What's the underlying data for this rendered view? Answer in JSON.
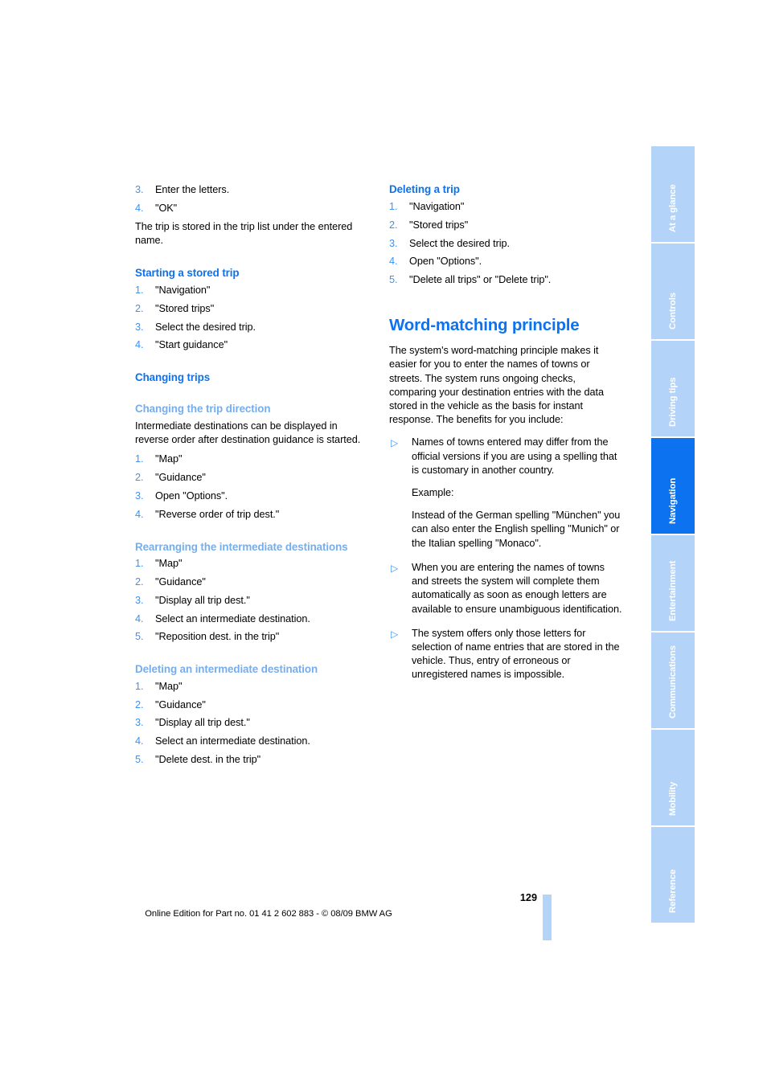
{
  "document": {
    "page_number": "129",
    "footer_text": "Online Edition for Part no. 01 41 2 602 883 - © 08/09 BMW AG"
  },
  "colors": {
    "accent_blue": "#0d72ef",
    "light_blue": "#76adec",
    "tab_blue": "#b4d3f9",
    "number_blue": "#3d93f2"
  },
  "left_column": {
    "continued_steps": [
      {
        "num": "3.",
        "text": "Enter the letters."
      },
      {
        "num": "4.",
        "text": "\"OK\""
      }
    ],
    "continued_para": "The trip is stored in the trip list under the entered name.",
    "starting_stored_trip": {
      "heading": "Starting a stored trip",
      "steps": [
        {
          "num": "1.",
          "text": "\"Navigation\""
        },
        {
          "num": "2.",
          "text": "\"Stored trips\""
        },
        {
          "num": "3.",
          "text": "Select the desired trip."
        },
        {
          "num": "4.",
          "text": "\"Start guidance\""
        }
      ]
    },
    "changing_trips": {
      "heading": "Changing trips"
    },
    "changing_direction": {
      "heading": "Changing the trip direction",
      "para": "Intermediate destinations can be displayed in reverse order after destination guidance is started.",
      "steps": [
        {
          "num": "1.",
          "text": "\"Map\""
        },
        {
          "num": "2.",
          "text": "\"Guidance\""
        },
        {
          "num": "3.",
          "text": "Open \"Options\"."
        },
        {
          "num": "4.",
          "text": "\"Reverse order of trip dest.\""
        }
      ]
    },
    "rearranging": {
      "heading": "Rearranging the intermediate destinations",
      "steps": [
        {
          "num": "1.",
          "text": "\"Map\""
        },
        {
          "num": "2.",
          "text": "\"Guidance\""
        },
        {
          "num": "3.",
          "text": "\"Display all trip dest.\""
        },
        {
          "num": "4.",
          "text": "Select an intermediate destination."
        },
        {
          "num": "5.",
          "text": "\"Reposition dest. in the trip\""
        }
      ]
    },
    "deleting_intermediate": {
      "heading": "Deleting an intermediate destination",
      "steps": [
        {
          "num": "1.",
          "text": "\"Map\""
        },
        {
          "num": "2.",
          "text": "\"Guidance\""
        },
        {
          "num": "3.",
          "text": "\"Display all trip dest.\""
        },
        {
          "num": "4.",
          "text": "Select an intermediate destination."
        },
        {
          "num": "5.",
          "text": "\"Delete dest. in the trip\""
        }
      ]
    }
  },
  "right_column": {
    "deleting_trip": {
      "heading": "Deleting a trip",
      "steps": [
        {
          "num": "1.",
          "text": "\"Navigation\""
        },
        {
          "num": "2.",
          "text": "\"Stored trips\""
        },
        {
          "num": "3.",
          "text": "Select the desired trip."
        },
        {
          "num": "4.",
          "text": "Open \"Options\"."
        },
        {
          "num": "5.",
          "text": "\"Delete all trips\" or \"Delete trip\"."
        }
      ]
    },
    "word_matching": {
      "title": "Word-matching principle",
      "intro": "The system's word-matching principle makes it easier for you to enter the names of towns or streets. The system runs ongoing checks, comparing your destination entries with the data stored in the vehicle as the basis for instant response. The benefits for you include:",
      "bullets": [
        {
          "marker": "triangle-right-icon",
          "text": "Names of towns entered may differ from the official versions if you are using a spelling that is customary in another country.",
          "example_label": "Example:",
          "example_text": "Instead of the German spelling \"München\" you can also enter the English spelling \"Munich\" or the Italian spelling \"Monaco\"."
        },
        {
          "marker": "triangle-right-icon",
          "text": "When you are entering the names of towns and streets the system will complete them automatically as soon as enough letters are available to ensure unambiguous identification."
        },
        {
          "marker": "triangle-right-icon",
          "text": "The system offers only those letters for selection of name entries that are stored in the vehicle. Thus, entry of erroneous or unregistered names is impossible."
        }
      ]
    }
  },
  "side_tabs": [
    {
      "label": "At a glance",
      "active": false
    },
    {
      "label": "Controls",
      "active": false
    },
    {
      "label": "Driving tips",
      "active": false
    },
    {
      "label": "Navigation",
      "active": true
    },
    {
      "label": "Entertainment",
      "active": false
    },
    {
      "label": "Communications",
      "active": false
    },
    {
      "label": "Mobility",
      "active": false
    },
    {
      "label": "Reference",
      "active": false
    }
  ]
}
